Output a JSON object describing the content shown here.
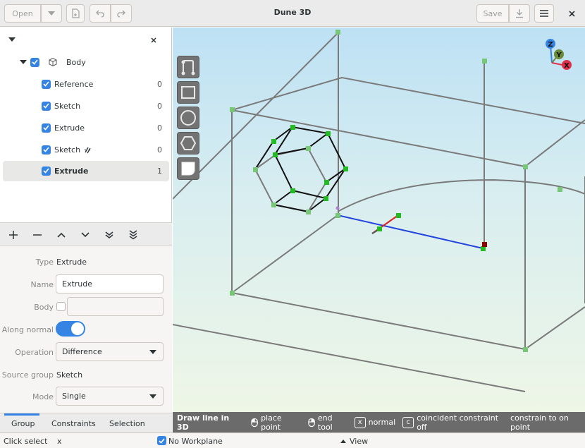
{
  "window": {
    "title": "Dune 3D"
  },
  "header": {
    "open_label": "Open",
    "save_label": "Save"
  },
  "tree": {
    "body_label": "Body",
    "items": [
      {
        "label": "Reference",
        "count": "0"
      },
      {
        "label": "Sketch",
        "count": "0"
      },
      {
        "label": "Extrude",
        "count": "0"
      },
      {
        "label": "Sketch",
        "count": "0"
      },
      {
        "label": "Extrude",
        "count": "1"
      }
    ]
  },
  "properties": {
    "type_label": "Type",
    "type_value": "Extrude",
    "name_label": "Name",
    "name_value": "Extrude",
    "body_label": "Body",
    "along_normal_label": "Along normal",
    "operation_label": "Operation",
    "operation_value": "Difference",
    "source_group_label": "Source group",
    "source_group_value": "Sketch",
    "mode_label": "Mode",
    "mode_value": "Single"
  },
  "tabs": [
    "Group",
    "Constraints",
    "Selection"
  ],
  "viewport_status": {
    "action": "Draw line in 3D",
    "hints": [
      {
        "key": "mouse-left",
        "text": "place point"
      },
      {
        "key": "mouse-right",
        "text": "end tool"
      },
      {
        "key": "x",
        "text": "normal"
      },
      {
        "key": "c",
        "text": "coincident constraint off"
      },
      {
        "key": "",
        "text": "constrain to on point"
      }
    ]
  },
  "axes": {
    "z": "Z",
    "y": "Y",
    "x": "X"
  },
  "statusbar": {
    "click_select": "Click select",
    "x_text": "x",
    "no_workplane": "No Workplane",
    "view": "View"
  },
  "colors": {
    "accent": "#3584e4",
    "point": "#22bb22",
    "axis_z": "#3584e4",
    "axis_y": "#6a8a3a",
    "axis_x": "#e0304a"
  }
}
